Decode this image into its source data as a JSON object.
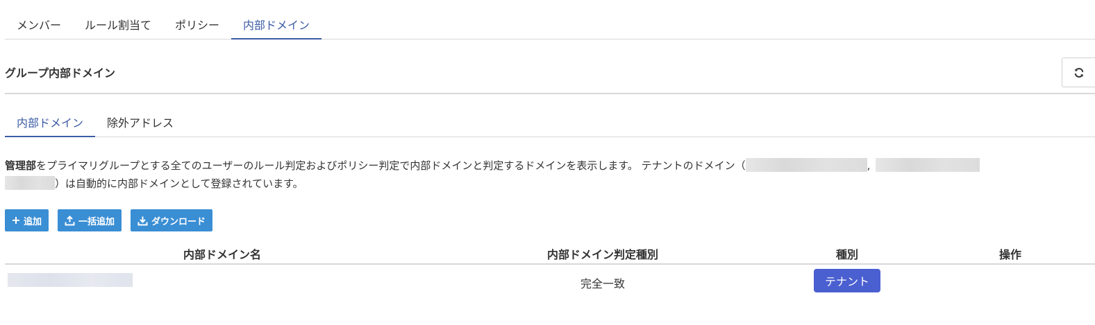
{
  "top_tabs": [
    "メンバー",
    "ルール割当て",
    "ポリシー",
    "内部ドメイン"
  ],
  "top_tab_active": "内部ドメイン",
  "section": {
    "title": "グループ内部ドメイン"
  },
  "sub_tabs": [
    "内部ドメイン",
    "除外アドレス"
  ],
  "sub_tab_active": "内部ドメイン",
  "description": {
    "group_name": "管理部",
    "text1": "をプライマリグループとする全てのユーザーのルール判定およびポリシー判定で内部ドメインと判定するドメインを表示します。 テナントのドメイン（",
    "separator": ",",
    "text2": "）は自動的に内部ドメインとして登録されています。"
  },
  "buttons": {
    "add": "追加",
    "bulk_add": "一括追加",
    "download": "ダウンロード"
  },
  "table": {
    "columns": [
      "内部ドメイン名",
      "内部ドメイン判定種別",
      "種別",
      "操作"
    ],
    "rows": [
      {
        "match_type": "完全一致",
        "kind": "テナント"
      }
    ]
  },
  "colors": {
    "accent": "#3b5ba5",
    "button": "#3a8ed4",
    "tag": "#4a5fd0"
  }
}
